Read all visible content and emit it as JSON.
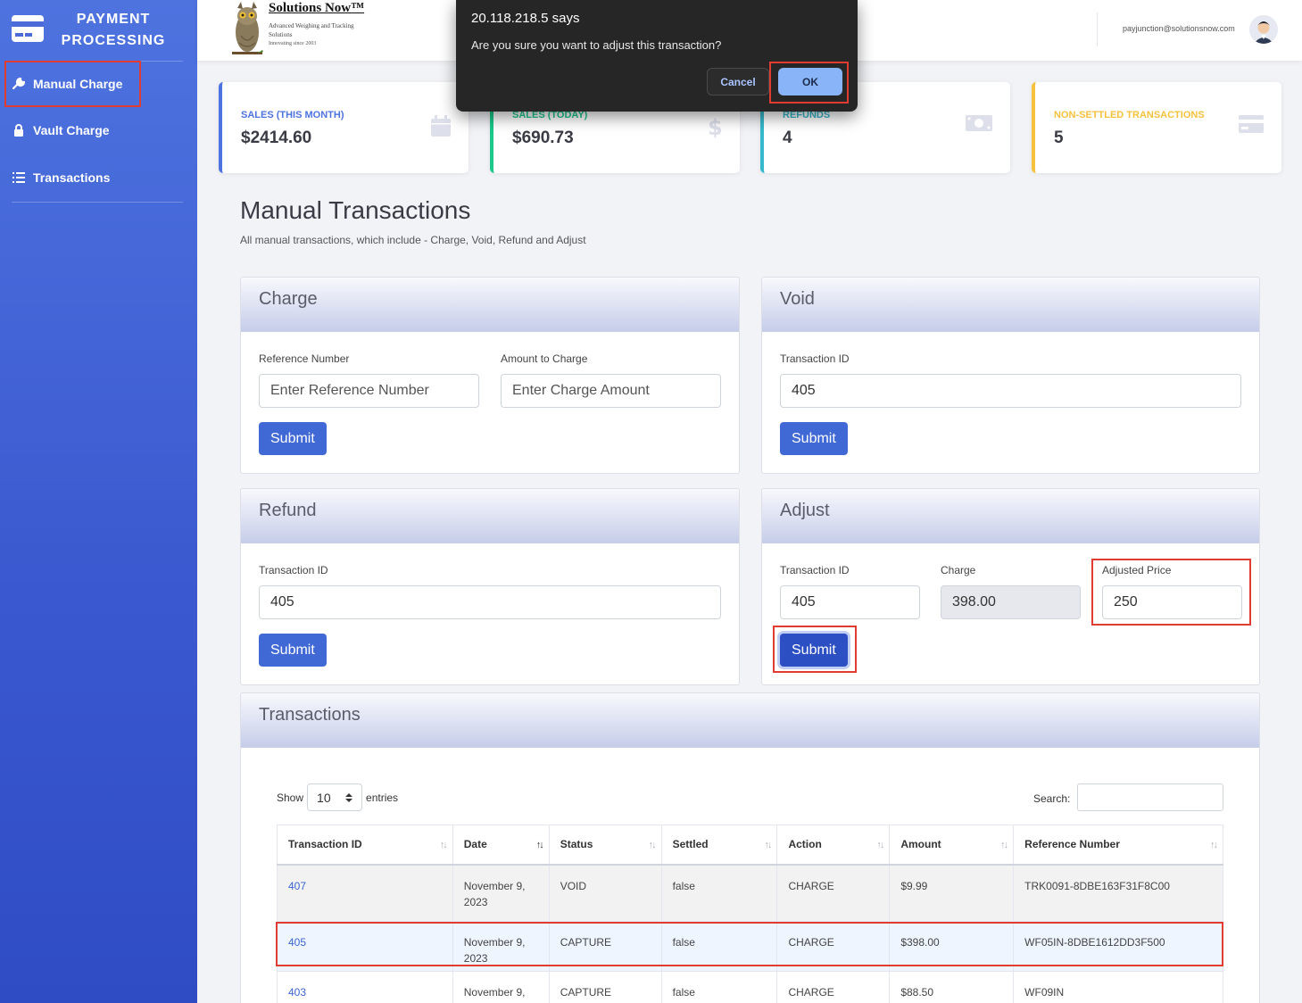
{
  "sidebar": {
    "brand": "PAYMENT PROCESSING",
    "items": [
      {
        "label": "Manual Charge",
        "icon": "wrench-icon"
      },
      {
        "label": "Vault Charge",
        "icon": "lock-icon"
      },
      {
        "label": "Transactions",
        "icon": "list-icon"
      }
    ]
  },
  "topbar": {
    "logo_title": "Solutions Now™",
    "logo_subtitle": "Advanced Weighing and Tracking Solutions",
    "logo_since": "Innovating since 2003",
    "user_email": "payjunction@solutionsnow.com"
  },
  "stats": [
    {
      "label": "SALES (THIS MONTH)",
      "value": "$2414.60",
      "color": "#4e73df",
      "icon": "calendar-icon"
    },
    {
      "label": "SALES (TODAY)",
      "value": "$690.73",
      "color": "#1cc88a",
      "icon": "dollar-icon"
    },
    {
      "label": "REFUNDS",
      "value": "4",
      "color": "#36b9cc",
      "icon": "money-bill-icon"
    },
    {
      "label": "NON-SETTLED TRANSACTIONS",
      "value": "5",
      "color": "#f6c23e",
      "icon": "credit-card-icon"
    }
  ],
  "page": {
    "title": "Manual Transactions",
    "subtitle": "All manual transactions, which include - Charge, Void, Refund and Adjust"
  },
  "charge": {
    "title": "Charge",
    "ref_label": "Reference Number",
    "ref_placeholder": "Enter Reference Number",
    "amount_label": "Amount to Charge",
    "amount_placeholder": "Enter Charge Amount",
    "submit": "Submit"
  },
  "void": {
    "title": "Void",
    "txid_label": "Transaction ID",
    "txid_value": "405",
    "submit": "Submit"
  },
  "refund": {
    "title": "Refund",
    "txid_label": "Transaction ID",
    "txid_value": "405",
    "submit": "Submit"
  },
  "adjust": {
    "title": "Adjust",
    "txid_label": "Transaction ID",
    "txid_value": "405",
    "charge_label": "Charge",
    "charge_value": "398.00",
    "price_label": "Adjusted Price",
    "price_value": "250",
    "submit": "Submit"
  },
  "transactions": {
    "title": "Transactions",
    "show_label": "Show",
    "show_value": "10",
    "entries_label": "entries",
    "search_label": "Search:",
    "columns": [
      "Transaction ID",
      "Date",
      "Status",
      "Settled",
      "Action",
      "Amount",
      "Reference Number"
    ],
    "rows": [
      {
        "id": "407",
        "date": "November 9, 2023",
        "status": "VOID",
        "settled": "false",
        "action": "CHARGE",
        "amount": "$9.99",
        "ref": "TRK0091-8DBE163F31F8C00"
      },
      {
        "id": "405",
        "date": "November 9, 2023",
        "status": "CAPTURE",
        "settled": "false",
        "action": "CHARGE",
        "amount": "$398.00",
        "ref": "WF05IN-8DBE1612DD3F500"
      },
      {
        "id": "403",
        "date": "November 9,",
        "status": "CAPTURE",
        "settled": "false",
        "action": "CHARGE",
        "amount": "$88.50",
        "ref": "WF09IN"
      }
    ]
  },
  "dialog": {
    "title": "20.118.218.5 says",
    "message": "Are you sure you want to adjust this transaction?",
    "cancel": "Cancel",
    "ok": "OK"
  }
}
